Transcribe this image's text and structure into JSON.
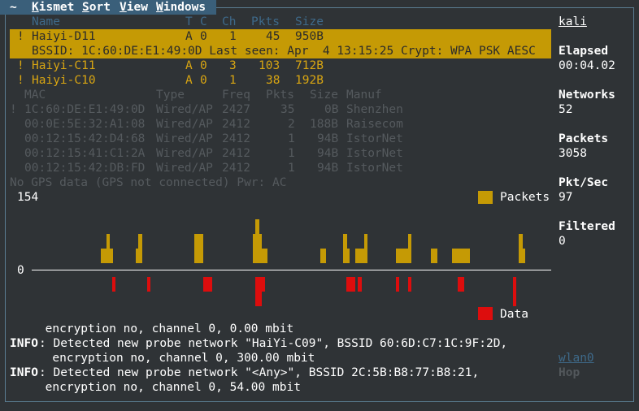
{
  "menu": {
    "tilde": "~",
    "items": [
      "Kismet",
      "Sort",
      "View",
      "Windows"
    ]
  },
  "net_headers": {
    "name": "Name",
    "t": "T",
    "c": "C",
    "ch": "Ch",
    "pkts": "Pkts",
    "size": "Size"
  },
  "networks": [
    {
      "flag": "!",
      "name": "Haiyi-D11",
      "t": "A",
      "c": "0",
      "ch": "1",
      "pkts": "45",
      "size": "950B",
      "selected": true
    },
    {
      "flag": "!",
      "name": "Haiyi-C11",
      "t": "A",
      "c": "0",
      "ch": "3",
      "pkts": "103",
      "size": "712B"
    },
    {
      "flag": "!",
      "name": "Haiyi-C10",
      "t": "A",
      "c": "0",
      "ch": "1",
      "pkts": "38",
      "size": "192B"
    }
  ],
  "bssid_line": "BSSID: 1C:60:DE:E1:49:0D Last seen: Apr  4 13:15:25 Crypt: WPA PSK AESC",
  "client_headers": {
    "mac": "MAC",
    "type": "Type",
    "freq": "Freq",
    "pkts": "Pkts",
    "size": "Size",
    "manuf": "Manuf"
  },
  "clients": [
    {
      "flag": "!",
      "mac": "1C:60:DE:E1:49:0D",
      "type": "Wired/AP",
      "freq": "2427",
      "pkts": "35",
      "size": "0B",
      "manuf": "Shenzhen"
    },
    {
      "flag": "",
      "mac": "00:0E:5E:32:A1:08",
      "type": "Wired/AP",
      "freq": "2412",
      "pkts": "2",
      "size": "188B",
      "manuf": "Raisecom"
    },
    {
      "flag": "",
      "mac": "00:12:15:42:D4:68",
      "type": "Wired/AP",
      "freq": "2412",
      "pkts": "1",
      "size": "94B",
      "manuf": "IstorNet"
    },
    {
      "flag": "",
      "mac": "00:12:15:41:C1:2A",
      "type": "Wired/AP",
      "freq": "2412",
      "pkts": "1",
      "size": "94B",
      "manuf": "IstorNet"
    },
    {
      "flag": "",
      "mac": "00:12:15:42:DB:FD",
      "type": "Wired/AP",
      "freq": "2412",
      "pkts": "1",
      "size": "94B",
      "manuf": "IstorNet"
    }
  ],
  "gps_line": "No GPS data (GPS not connected) Pwr: AC",
  "graph": {
    "ymax_label": "154",
    "zero_label": "0",
    "packets_label": "Packets",
    "data_label": "Data"
  },
  "chart_data": {
    "type": "bar",
    "ylim": [
      0,
      154
    ],
    "packets": [
      0,
      0,
      0,
      0,
      0,
      0,
      0,
      0,
      0,
      0,
      0,
      0,
      0,
      0,
      0,
      0,
      1,
      1,
      2,
      1,
      0,
      0,
      0,
      0,
      0,
      0,
      0,
      0,
      1,
      2,
      0,
      0,
      0,
      0,
      0,
      0,
      0,
      0,
      0,
      0,
      0,
      0,
      0,
      0,
      0,
      0,
      0,
      0,
      2,
      2,
      2,
      0,
      0,
      0,
      0,
      0,
      0,
      0,
      0,
      0,
      0,
      0,
      0,
      0,
      0,
      0,
      0,
      0,
      2,
      3,
      2,
      1,
      1,
      0,
      0,
      0,
      0,
      0,
      0,
      0,
      0,
      0,
      0,
      0,
      0,
      0,
      0,
      0,
      0,
      0,
      0,
      1,
      1,
      0,
      0,
      0,
      0,
      0,
      0,
      2,
      1,
      0,
      0,
      1,
      1,
      1,
      2,
      0,
      0,
      0,
      0,
      0,
      0,
      0,
      0,
      0,
      0,
      1,
      1,
      1,
      1,
      2,
      0,
      0,
      0,
      0,
      0,
      0,
      0,
      1,
      1,
      0,
      0,
      0,
      0,
      0,
      1,
      1,
      1,
      1,
      1,
      1,
      0,
      0,
      0,
      0,
      0,
      0,
      0,
      0,
      0,
      0,
      0,
      0,
      0,
      0,
      0,
      0,
      0,
      2,
      1
    ],
    "data": [
      0,
      0,
      0,
      0,
      0,
      0,
      0,
      0,
      0,
      0,
      0,
      0,
      0,
      0,
      0,
      0,
      0,
      0,
      0,
      0,
      1,
      0,
      0,
      0,
      0,
      0,
      0,
      0,
      0,
      0,
      0,
      0,
      1,
      0,
      0,
      0,
      0,
      0,
      0,
      0,
      0,
      0,
      0,
      0,
      0,
      0,
      0,
      0,
      0,
      0,
      0,
      1,
      1,
      1,
      0,
      0,
      0,
      0,
      0,
      0,
      0,
      0,
      0,
      0,
      0,
      0,
      0,
      0,
      0,
      2,
      2,
      1,
      0,
      0,
      0,
      0,
      0,
      0,
      0,
      0,
      0,
      0,
      0,
      0,
      0,
      0,
      0,
      0,
      0,
      0,
      0,
      0,
      0,
      0,
      0,
      0,
      0,
      0,
      0,
      0,
      1,
      1,
      1,
      0,
      1,
      0,
      0,
      0,
      0,
      0,
      0,
      0,
      0,
      0,
      0,
      0,
      0,
      1,
      0,
      0,
      0,
      1,
      0,
      0,
      0,
      0,
      0,
      0,
      0,
      0,
      0,
      0,
      0,
      0,
      0,
      0,
      0,
      0,
      1,
      1,
      0,
      0,
      0,
      0,
      0,
      0,
      0,
      0,
      0,
      0,
      0,
      0,
      0,
      0,
      0,
      0,
      0,
      2,
      0
    ],
    "series": [
      {
        "name": "Packets",
        "color": "#c59a05"
      },
      {
        "name": "Data",
        "color": "#dd0d0d"
      }
    ]
  },
  "log": {
    "line1": "     encryption no, channel 0, 0.00 mbit",
    "info1_label": "INFO",
    "info1_text": ": Detected new probe network \"HaiYi-C09\", BSSID 60:6D:C7:1C:9F:2D,",
    "line3": "      encryption no, channel 0, 300.00 mbit",
    "info2_label": "INFO",
    "info2_text": ": Detected new probe network \"<Any>\", BSSID 2C:5B:B8:77:B8:21,",
    "line5": "     encryption no, channel 0, 54.00 mbit"
  },
  "sidebar": {
    "host": "kali",
    "elapsed_label": "Elapsed",
    "elapsed_value": "00:04.02",
    "networks_label": "Networks",
    "networks_value": "52",
    "packets_label": "Packets",
    "packets_value": "3058",
    "pktsec_label": "Pkt/Sec",
    "pktsec_value": "97",
    "filtered_label": "Filtered",
    "filtered_value": "0",
    "iface": "wlan0",
    "hop": "Hop"
  },
  "colors": {
    "background": "#2f3336",
    "accent": "#c59a05",
    "data": "#dd0d0d",
    "header": "#3e6a8a"
  }
}
